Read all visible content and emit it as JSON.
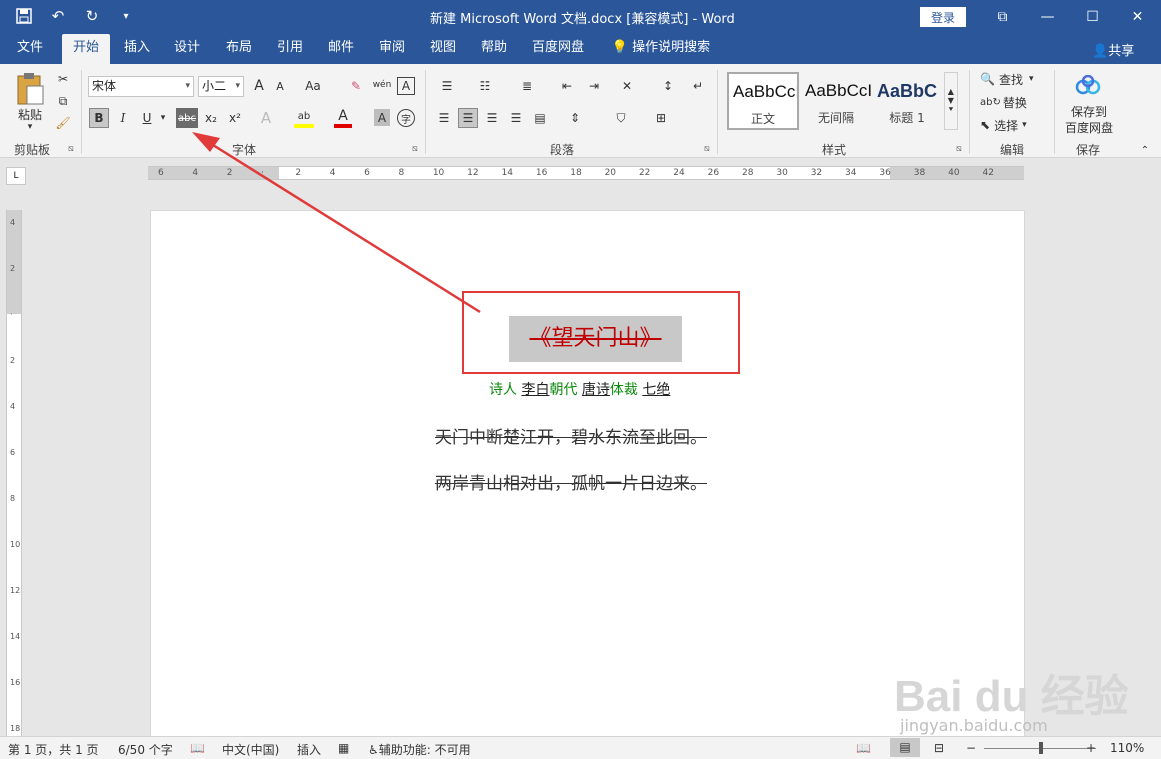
{
  "titlebar": {
    "title": "新建 Microsoft Word 文档.docx [兼容模式]  -  Word",
    "login": "登录",
    "qat_save": "💾",
    "qat_undo": "↶",
    "qat_redo": "↻",
    "qat_more": "▾",
    "minimize": "—",
    "restore": "☐",
    "close": "✕",
    "ribbon_display": "⧉",
    "icons": [
      "save-icon",
      "undo-icon",
      "redo-icon",
      "customize-icon",
      "ribbon-display-icon",
      "minimize-icon",
      "maximize-icon",
      "close-icon"
    ]
  },
  "tabs": {
    "file": "文件",
    "home": "开始",
    "insert": "插入",
    "design": "设计",
    "layout": "布局",
    "references": "引用",
    "mailings": "邮件",
    "review": "审阅",
    "view": "视图",
    "help": "帮助",
    "baidu": "百度网盘",
    "tell_me": "操作说明搜索",
    "share": "共享"
  },
  "ribbon": {
    "clipboard": {
      "label": "剪贴板",
      "paste": "粘贴"
    },
    "font": {
      "label": "字体",
      "font_name": "宋体",
      "font_size": "小二",
      "bold": "B",
      "italic": "I",
      "underline": "U",
      "strikethrough": "abc",
      "subscript": "x₂",
      "superscript": "x²",
      "grow": "A",
      "shrink": "A",
      "change_case": "Aa",
      "phonetic": "wén",
      "border_char": "A",
      "highlight": "ab",
      "font_color": "A",
      "shading": "A",
      "enclose": "字"
    },
    "paragraph": {
      "label": "段落"
    },
    "styles": {
      "label": "样式",
      "items": [
        {
          "sample": "AaBbCcI",
          "name": "正文"
        },
        {
          "sample": "AaBbCcI",
          "name": "无间隔"
        },
        {
          "sample": "AaBbC",
          "name": "标题 1"
        }
      ]
    },
    "editing": {
      "label": "编辑",
      "find": "查找",
      "replace": "替换",
      "select": "选择"
    },
    "save_group": {
      "label": "保存",
      "save_to": "保存到",
      "baidu": "百度网盘"
    }
  },
  "ruler": {
    "h_numbers": [
      "6",
      "4",
      "2",
      "",
      "2",
      "4",
      "6",
      "8",
      "10",
      "12",
      "14",
      "16",
      "18",
      "20",
      "22",
      "24",
      "26",
      "28",
      "30",
      "32",
      "34",
      "36",
      "38",
      "40",
      "42"
    ],
    "v_numbers": [
      "4",
      "2",
      "",
      "2",
      "4",
      "6",
      "8",
      "10",
      "12",
      "14",
      "16",
      "18"
    ],
    "corner": "L"
  },
  "document": {
    "title": "《望天门山》",
    "meta": {
      "poet_label": "诗人",
      "poet": "李白",
      "dynasty_label": "朝代",
      "dynasty": "唐诗",
      "genre_label": "体裁",
      "genre": "七绝"
    },
    "lines": [
      "天门中断楚江开，碧水东流至此回。",
      "两岸青山相对出，孤帆一片日边来。"
    ]
  },
  "statusbar": {
    "page": "第 1 页，共 1 页",
    "words": "6/50 个字",
    "language": "中文(中国)",
    "mode": "插入",
    "accessibility": "辅助功能: 不可用",
    "zoom_minus": "−",
    "zoom_plus": "+",
    "zoom": "110%",
    "zoom_level_percent": 110
  },
  "watermark": {
    "text": "Bai du 经验",
    "sub": "jingyan.baidu.com"
  },
  "colors": {
    "brand": "#2b579a",
    "title_red": "#c00000",
    "highlight_box": "#e03a3a",
    "meta_green": "#0b8a0b"
  }
}
